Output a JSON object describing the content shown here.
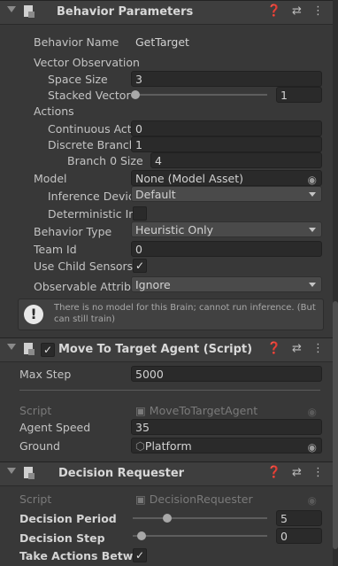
{
  "behavior_parameters": {
    "title": "Behavior Parameters",
    "fields": {
      "behavior_name": {
        "label": "Behavior Name",
        "value": "GetTarget"
      },
      "vector_observation": {
        "label": "Vector Observation"
      },
      "space_size": {
        "label": "Space Size",
        "value": "3"
      },
      "stacked_vectors": {
        "label": "Stacked Vector",
        "value": "1",
        "slider_fraction": 0.0
      },
      "actions": {
        "label": "Actions"
      },
      "continuous_actions": {
        "label": "Continuous Acti",
        "value": "0"
      },
      "discrete_branches": {
        "label": "Discrete Branch",
        "value": "1"
      },
      "branch0_size": {
        "label": "Branch 0 Size",
        "value": "4"
      },
      "model": {
        "label": "Model",
        "value": "None (Model Asset)"
      },
      "inference_device": {
        "label": "Inference Devic",
        "value": "Default"
      },
      "deterministic_inference": {
        "label": "Deterministic Inf",
        "checked": false
      },
      "behavior_type": {
        "label": "Behavior Type",
        "value": "Heuristic Only"
      },
      "team_id": {
        "label": "Team Id",
        "value": "0"
      },
      "use_child_sensors": {
        "label": "Use Child Sensors",
        "checked": true,
        "check_glyph": "✓"
      },
      "observable_attribute": {
        "label": "Observable Attribu",
        "value": "Ignore"
      }
    },
    "help_message": "There is no model for this Brain; cannot run inference. (But can still train)",
    "help_glyph": "!"
  },
  "move_to_target": {
    "title": "Move To Target Agent (Script)",
    "enabled_glyph": "✓",
    "max_step": {
      "label": "Max Step",
      "value": "5000"
    },
    "script": {
      "label": "Script",
      "value": "MoveToTargetAgent"
    },
    "agent_speed": {
      "label": "Agent Speed",
      "value": "35"
    },
    "ground": {
      "label": "Ground",
      "value": "Platform"
    }
  },
  "decision_requester": {
    "title": "Decision Requester",
    "script": {
      "label": "Script",
      "value": "DecisionRequester"
    },
    "decision_period": {
      "label": "Decision Period",
      "value": "5",
      "slider_fraction": 0.2
    },
    "decision_step": {
      "label": "Decision Step",
      "value": "0",
      "slider_fraction": 0.0
    },
    "take_actions": {
      "label": "Take Actions Betwee",
      "checked": true,
      "check_glyph": "✓"
    }
  },
  "header_icons": {
    "help": "❓",
    "presets": "⇄",
    "menu": "⋮"
  },
  "target_glyph": "◉",
  "colors": {
    "background": "#383838",
    "field": "#2a2a2a",
    "header": "#3e3e3e"
  }
}
